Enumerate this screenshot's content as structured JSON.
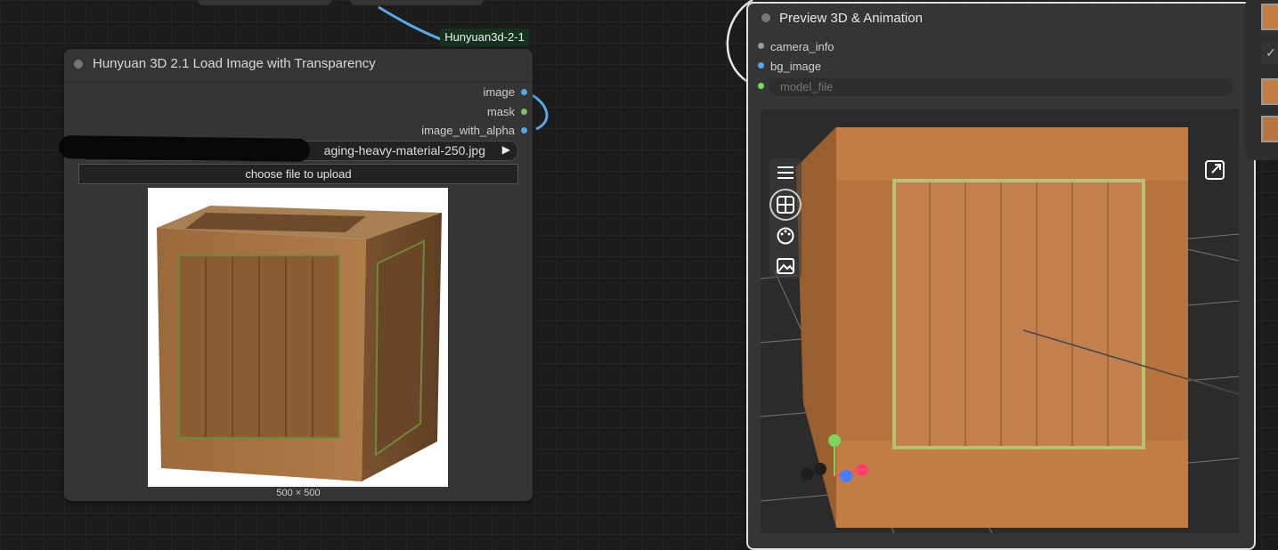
{
  "reroute_label": "Hunyuan3d-2-1",
  "load_node": {
    "title": "Hunyuan 3D 2.1 Load Image with Transparency",
    "outputs": [
      {
        "label": "image",
        "color": "#5aa7e8"
      },
      {
        "label": "mask",
        "color": "#7fbf6a"
      },
      {
        "label": "image_with_alpha",
        "color": "#5aa7e8"
      }
    ],
    "file_value": "aging-heavy-material-250.jpg",
    "upload_label": "choose file to upload",
    "image_size": "500 × 500"
  },
  "preview_node": {
    "title": "Preview 3D & Animation",
    "inputs": [
      {
        "label": "camera_info",
        "color": "#9a9a9a"
      },
      {
        "label": "bg_image",
        "color": "#5aa7e8"
      }
    ],
    "model_input": {
      "placeholder": "model_file",
      "color": "#7cd65c"
    },
    "toolbar_icons": [
      "menu-icon",
      "grid-icon",
      "palette-icon",
      "image-icon"
    ],
    "fullscreen_icon": "expand-icon",
    "axis_colors": {
      "y": "#7cd65c",
      "x": "#ff4466",
      "z": "#4a7cff"
    }
  },
  "colors": {
    "wire_blue": "#5aa7e8",
    "wire_white": "#e8e8e8",
    "node_bg": "#353535"
  }
}
